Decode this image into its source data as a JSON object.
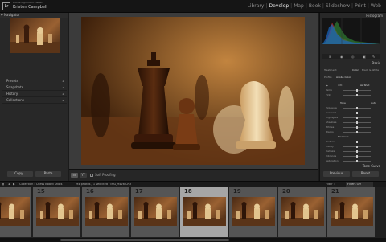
{
  "topbar": {
    "brand": "Adobe Lightroom Classic",
    "user": "Kristen Campbell"
  },
  "modules": [
    {
      "label": "Library",
      "active": false
    },
    {
      "label": "Develop",
      "active": true
    },
    {
      "label": "Map",
      "active": false
    },
    {
      "label": "Book",
      "active": false
    },
    {
      "label": "Slideshow",
      "active": false
    },
    {
      "label": "Print",
      "active": false
    },
    {
      "label": "Web",
      "active": false
    }
  ],
  "left": {
    "navigator": "Navigator",
    "panels": [
      "Presets",
      "Snapshots",
      "History",
      "Collections"
    ],
    "copy": "Copy...",
    "paste": "Paste"
  },
  "toolbar": {
    "softproof": "Soft Proofing"
  },
  "right": {
    "histogram": "Histogram",
    "basic": "Basic",
    "treatment": "Treatment:",
    "color": "Color",
    "bw": "Black & White",
    "profile": "Profile:",
    "profile_value": "Adobe Color",
    "wb": "WB:",
    "wb_value": "As Shot",
    "tone": "Tone",
    "auto": "Auto",
    "presence": "Presence",
    "tone_curve": "Tone Curve",
    "previous": "Previous",
    "reset": "Reset",
    "wb_sliders": [
      "Temp",
      "Tint"
    ],
    "tone_sliders": [
      "Exposure",
      "Contrast",
      "Highlights",
      "Shadows",
      "Whites",
      "Blacks"
    ],
    "presence_sliders": [
      "Texture",
      "Clarity",
      "Dehaze",
      "Vibrance",
      "Saturation"
    ]
  },
  "filmbar": {
    "path": "Collection : Chess Board Shots",
    "counts": "94 photos / 1 selected / IMG_9426.CR3",
    "filter": "Filter :",
    "filter_value": "Filters Off"
  },
  "filmstrip": {
    "numbers": [
      "14",
      "15",
      "16",
      "17",
      "18",
      "19",
      "20",
      "21"
    ],
    "selected_index": 4
  },
  "colors": {
    "accent": "#e8e8e8",
    "selected_cell": "#a6a6a6"
  }
}
